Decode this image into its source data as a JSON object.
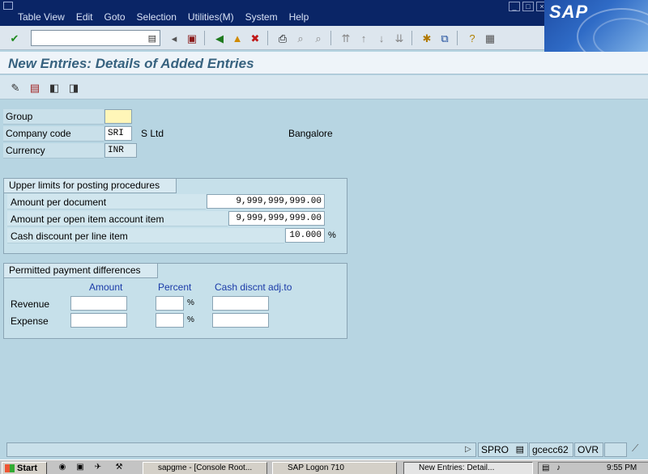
{
  "menubar": {
    "items": [
      "Table View",
      "Edit",
      "Goto",
      "Selection",
      "Utilities(M)",
      "System",
      "Help"
    ],
    "logo": "SAP"
  },
  "toolbar": {
    "command_value": "",
    "icons": [
      "enter-icon",
      "command-dropdown-icon",
      "back-arrow-icon",
      "save-icon",
      "back-icon",
      "exit-icon",
      "cancel-icon",
      "print-icon",
      "find-icon",
      "find-next-icon",
      "first-page-icon",
      "previous-page-icon",
      "next-page-icon",
      "last-page-icon",
      "create-session-icon",
      "shortcut-icon",
      "help-icon",
      "layout-icon"
    ]
  },
  "title": "New Entries: Details of Added Entries",
  "form": {
    "group_label": "Group",
    "group_value": "",
    "company_code_label": "Company code",
    "company_code_value": "SRI",
    "company_name": "S Ltd",
    "city": "Bangalore",
    "currency_label": "Currency",
    "currency_value": "INR"
  },
  "upper_limits": {
    "title": "Upper limits for posting procedures",
    "rows": [
      {
        "label": "Amount per document",
        "value": "9,999,999,999.00",
        "unit": ""
      },
      {
        "label": "Amount per open item account item",
        "value": "9,999,999,999.00",
        "unit": ""
      },
      {
        "label": "Cash discount per line item",
        "value": "10.000",
        "unit": "%"
      }
    ]
  },
  "payment_diff": {
    "title": "Permitted payment differences",
    "headers": {
      "amount": "Amount",
      "percent": "Percent",
      "cash": "Cash discnt adj.to"
    },
    "rows": [
      {
        "label": "Revenue",
        "amount": "",
        "percent": "",
        "unit": "%",
        "cash": ""
      },
      {
        "label": "Expense",
        "amount": "",
        "percent": "",
        "unit": "%",
        "cash": ""
      }
    ]
  },
  "status": {
    "message": "",
    "transaction": "SPRO",
    "server": "gcecc62",
    "mode": "OVR"
  },
  "taskbar": {
    "start": "Start",
    "tasks": [
      "sapgme - [Console Root...",
      "SAP Logon 710",
      "New Entries: Detail..."
    ],
    "clock": "9:55 PM"
  }
}
